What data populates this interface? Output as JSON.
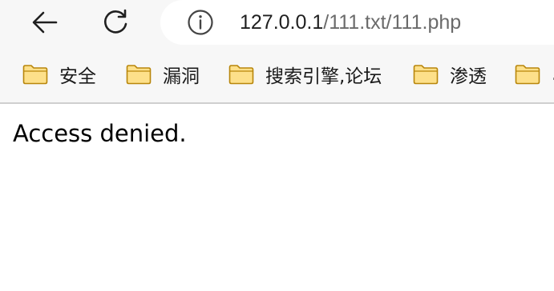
{
  "browser": {
    "address_bar": {
      "url_host": "127.0.0.1",
      "url_path": "/111.txt/111.php"
    },
    "bookmarks": [
      {
        "label": "安全"
      },
      {
        "label": "漏洞"
      },
      {
        "label": "搜索引擎,论坛"
      },
      {
        "label": "渗透"
      },
      {
        "label": "..."
      }
    ]
  },
  "page": {
    "message": "Access denied."
  },
  "colors": {
    "folder_fill": "#fde08a",
    "folder_stroke": "#b8860b",
    "toolbar_bg": "#f7f7f7"
  }
}
